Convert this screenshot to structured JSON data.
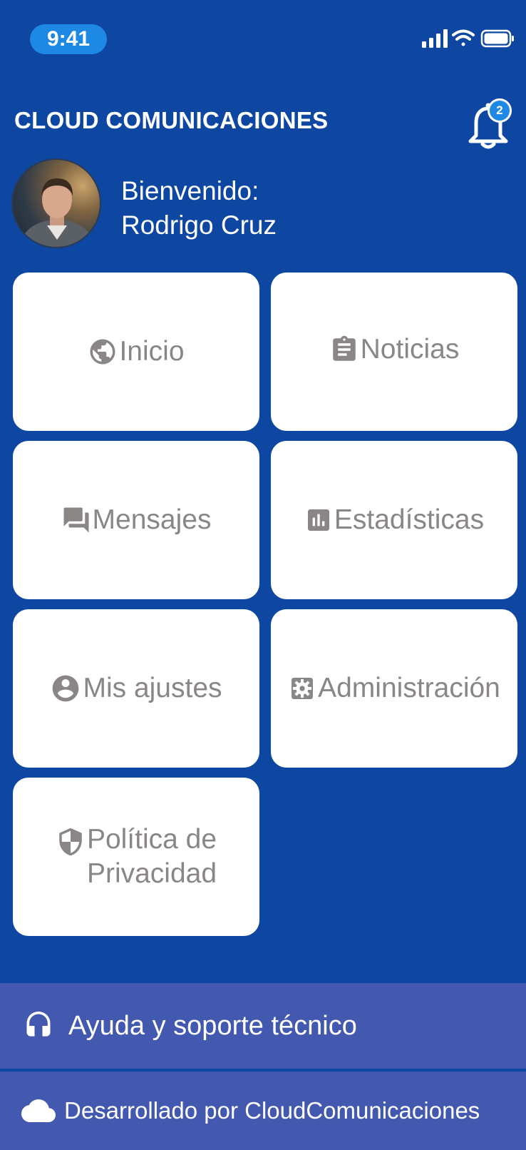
{
  "status_bar": {
    "time": "9:41",
    "icons": [
      "cellular-signal-icon",
      "wifi-icon",
      "battery-icon"
    ]
  },
  "header": {
    "app_title": "CLOUD COMUNICACIONES",
    "notification_count": "2"
  },
  "user": {
    "greeting": "Bienvenido:",
    "name": "Rodrigo Cruz"
  },
  "menu": {
    "items": [
      {
        "label": "Inicio",
        "icon": "globe-icon"
      },
      {
        "label": "Noticias",
        "icon": "clipboard-icon"
      },
      {
        "label": "Mensajes",
        "icon": "chat-icon"
      },
      {
        "label": "Estadísticas",
        "icon": "bar-chart-icon"
      },
      {
        "label": "Mis ajustes",
        "icon": "account-circle-icon"
      },
      {
        "label": "Administración",
        "icon": "gear-icon"
      },
      {
        "label_line1": "Política de",
        "label_line2": "Privacidad",
        "icon": "shield-icon"
      }
    ]
  },
  "footer": {
    "help_label": "Ayuda y soporte técnico",
    "developer_label": "Desarrollado por CloudComunicaciones"
  },
  "colors": {
    "background": "#0d47a1",
    "accent": "#1e88e5",
    "tile_text": "#8b8686",
    "footer_bar": "#4358af"
  }
}
